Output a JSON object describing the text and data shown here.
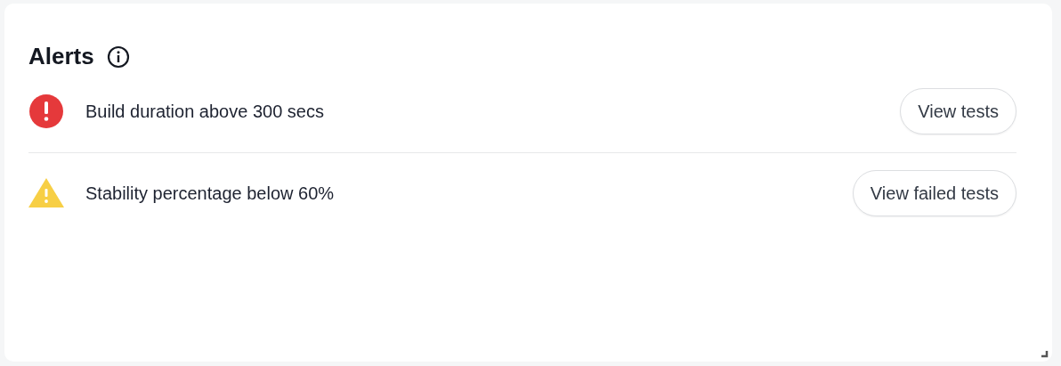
{
  "card": {
    "title": "Alerts",
    "alerts": [
      {
        "kind": "error",
        "message": "Build duration above 300 secs",
        "action": "View tests"
      },
      {
        "kind": "warning",
        "message": "Stability percentage below 60%",
        "action": "View failed tests"
      }
    ]
  }
}
